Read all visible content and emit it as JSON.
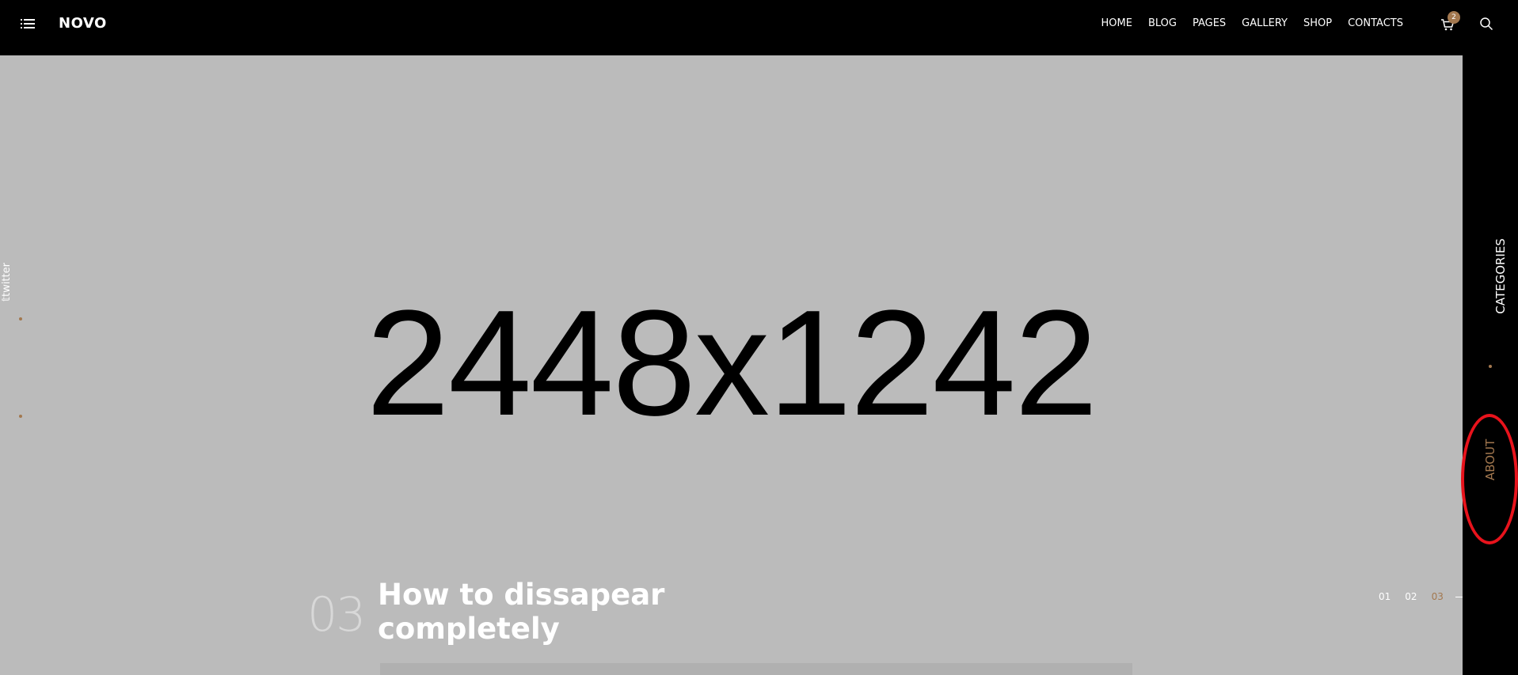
{
  "header": {
    "logo": "NOVO",
    "nav": [
      "HOME",
      "BLOG",
      "PAGES",
      "GALLERY",
      "SHOP",
      "CONTACTS"
    ],
    "active_nav": "HOME",
    "cart_count": "2",
    "icons": [
      "menu-icon",
      "cart-icon",
      "search-icon"
    ]
  },
  "hero": {
    "placeholder_text": "2448x1242",
    "slide_number": "03",
    "slide_title": "How to dissapear completely",
    "pager": [
      "01",
      "02",
      "03"
    ],
    "active_page": "03"
  },
  "social": [
    "facebook",
    "instagram",
    "twitter"
  ],
  "rightbar": {
    "categories_label": "CATEGORIES",
    "about_label": "ABOUT"
  },
  "colors": {
    "accent": "#a3784f",
    "header_bg": "#000000",
    "hero_bg": "#bbbbbb",
    "highlight": "#e8131c"
  }
}
